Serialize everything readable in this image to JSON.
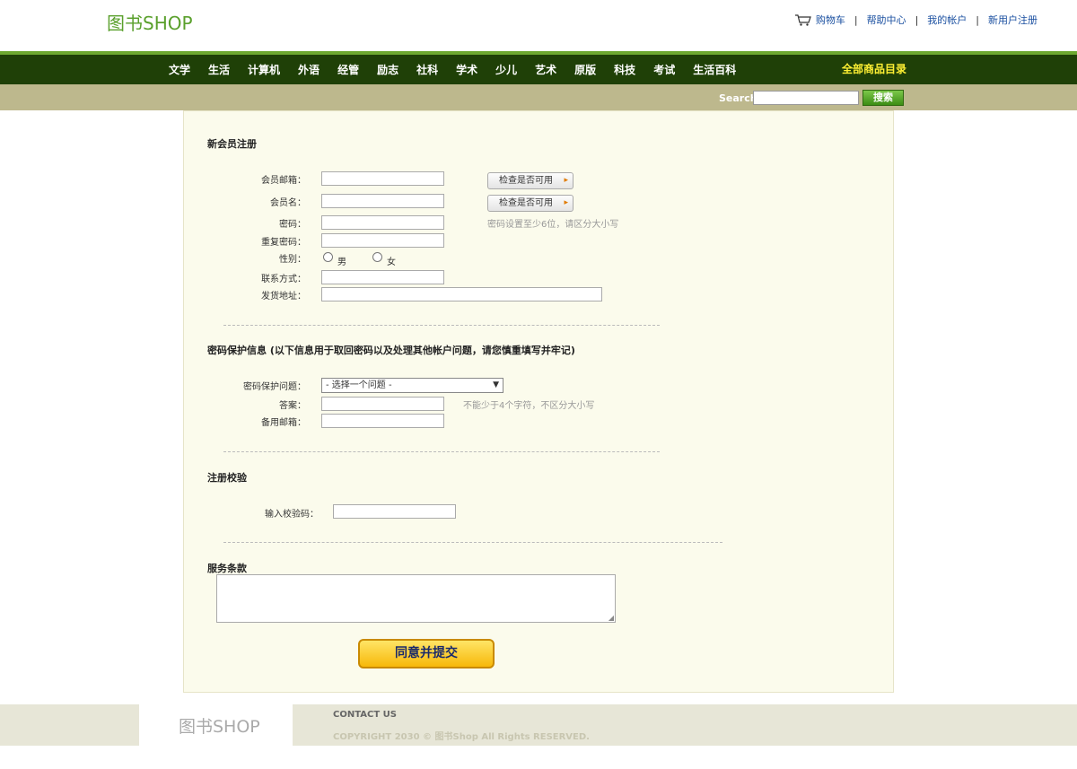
{
  "header": {
    "logo": "图书SHOP",
    "links": [
      "购物车",
      "帮助中心",
      "我的帐户",
      "新用户注册"
    ],
    "separator": "|"
  },
  "nav": {
    "items": [
      "文学",
      "生活",
      "计算机",
      "外语",
      "经管",
      "励志",
      "社科",
      "学术",
      "少儿",
      "艺术",
      "原版",
      "科技",
      "考试",
      "生活百科"
    ],
    "all_label": "全部商品目录"
  },
  "search": {
    "label": "Search",
    "button": "搜索"
  },
  "register": {
    "title": "新会员注册",
    "email_label": "会员邮箱：",
    "username_label": "会员名：",
    "password_label": "密码：",
    "confirm_label": "重复密码：",
    "gender_label": "性别：",
    "gender_male": "男",
    "gender_female": "女",
    "contact_label": "联系方式：",
    "address_label": "发货地址：",
    "check_button": "检查是否可用",
    "password_hint": "密码设置至少6位，请区分大小写"
  },
  "security": {
    "title": "密码保护信息 (以下信息用于取回密码以及处理其他帐户问题，请您慎重填写并牢记)",
    "question_label": "密码保护问题：",
    "question_selected": "- 选择一个问题 -",
    "answer_label": "答案：",
    "answer_hint": "不能少于4个字符，不区分大小写",
    "backup_email_label": "备用邮箱："
  },
  "verify": {
    "title": "注册校验",
    "code_label": "输入校验码："
  },
  "terms": {
    "title": "服务条款"
  },
  "submit_label": "同意并提交",
  "footer": {
    "logo": "图书SHOP",
    "contact": "CONTACT US",
    "copyright": "COPYRIGHT 2030 © 图书Shop All Rights RESERVED."
  },
  "icons": {
    "cart": "cart-icon",
    "arrow": "arrow-right-icon",
    "chevron": "chevron-down-icon"
  },
  "colors": {
    "nav_bg": "#1f4007",
    "nav_accent": "#6da830",
    "search_bg": "#bdb88d",
    "logo": "#5aa02c",
    "highlight": "#fff033"
  }
}
